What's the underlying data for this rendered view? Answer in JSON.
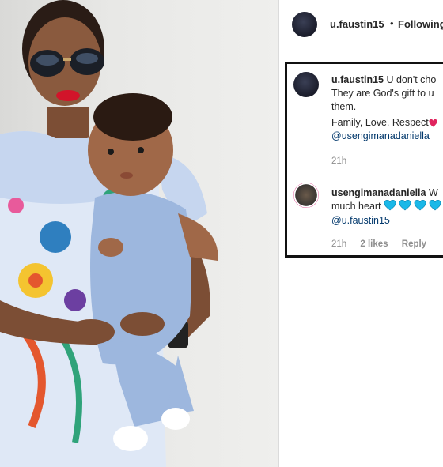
{
  "header": {
    "username": "u.faustin15",
    "separator": "•",
    "follow_label": "Following"
  },
  "comments": [
    {
      "username": "u.faustin15",
      "text_line1": "U don't cho",
      "text_line2": "They are God's gift to u",
      "text_line3": "them.",
      "text_line4": "Family, Love, Respect",
      "mention": "@usengimanadaniella",
      "time": "21h"
    },
    {
      "username": "usengimanadaniella",
      "text_line1": "W",
      "text_line2": "much heart",
      "mention": "@u.faustin15",
      "time": "21h",
      "likes": "2 likes",
      "reply_label": "Reply"
    }
  ],
  "colors": {
    "heart_red": "#e0245e",
    "heart_blue": "#1ab8e8",
    "mention": "#00376b",
    "muted": "#8e8e8e",
    "highlight_border": "#111111"
  }
}
